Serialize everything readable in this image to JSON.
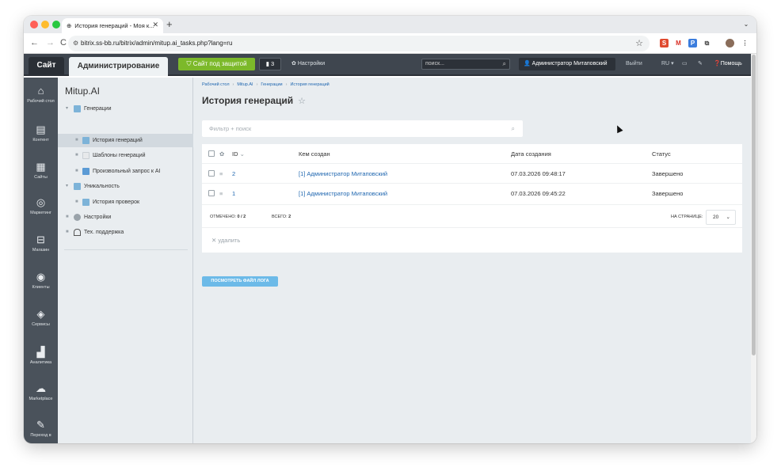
{
  "browser": {
    "tab_title": "История генераций - Моя к...",
    "url": "bitrix.ss-bb.ru/bitrix/admin/mitup.ai_tasks.php?lang=ru"
  },
  "topbar": {
    "site_tab": "Сайт",
    "admin_tab": "Администрирование",
    "protected_label": "Сайт под защитой",
    "updates_count": "3",
    "settings_label": "Настройки",
    "search_placeholder": "поиск...",
    "user_label": "Администратор Митаповский",
    "logout_label": "Выйти",
    "lang_label": "RU",
    "help_label": "Помощь"
  },
  "sidebar": {
    "items": [
      {
        "label": "Рабочий стол",
        "icon": "home-icon"
      },
      {
        "label": "Контент",
        "icon": "content-icon"
      },
      {
        "label": "Сайты",
        "icon": "calendar-icon"
      },
      {
        "label": "Маркетинг",
        "icon": "target-icon"
      },
      {
        "label": "Магазин",
        "icon": "cart-icon"
      },
      {
        "label": "Клиенты",
        "icon": "clients-icon"
      },
      {
        "label": "Сервисы",
        "icon": "layers-icon"
      },
      {
        "label": "Аналитика",
        "icon": "chart-icon"
      },
      {
        "label": "Marketplace",
        "icon": "cloud-icon"
      },
      {
        "label": "Переход в",
        "icon": "edit-icon"
      }
    ]
  },
  "menu": {
    "title": "Mitup.AI",
    "items": [
      {
        "label": "Генерации"
      },
      {
        "label": "История генераций"
      },
      {
        "label": "Шаблоны генераций"
      },
      {
        "label": "Произвольный запрос к AI"
      },
      {
        "label": "Уникальность"
      },
      {
        "label": "История проверок"
      },
      {
        "label": "Настройки"
      },
      {
        "label": "Тех. поддержка"
      }
    ]
  },
  "main": {
    "breadcrumb": [
      "Рабочий стол",
      "Mitup.AI",
      "Генерации",
      "История генераций"
    ],
    "title": "История генераций",
    "filter_placeholder": "Фильтр + поиск",
    "columns": {
      "id": "ID",
      "creator": "Кем создан",
      "date": "Дата создания",
      "status": "Статус"
    },
    "rows": [
      {
        "id": "2",
        "creator": "[1] Администратор Митаповский",
        "date": "07.03.2026 09:48:17",
        "status": "Завершено"
      },
      {
        "id": "1",
        "creator": "[1] Администратор Митаповский",
        "date": "07.03.2026 09:45:22",
        "status": "Завершено"
      }
    ],
    "selected_label": "ОТМЕЧЕНО:",
    "selected_value": "0 / 2",
    "total_label": "ВСЕГО:",
    "total_value": "2",
    "per_page_label": "НА СТРАНИЦЕ:",
    "per_page_value": "20",
    "delete_label": "удалить",
    "log_button": "ПОСМОТРЕТЬ ФАЙЛ ЛОГА"
  }
}
